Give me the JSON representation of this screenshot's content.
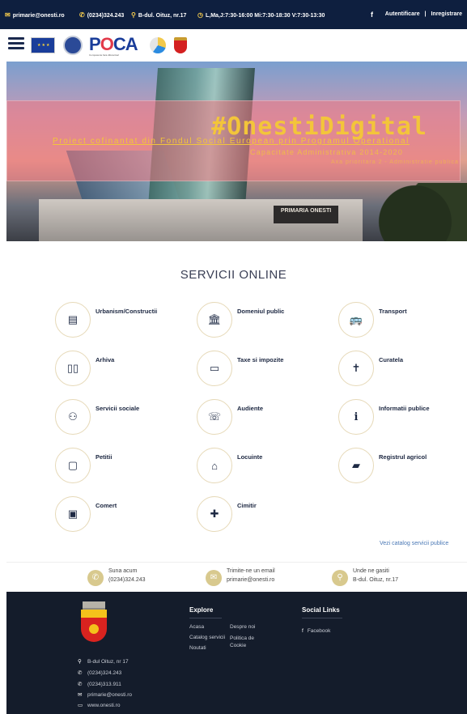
{
  "topbar": {
    "email": "primarie@onesti.ro",
    "phone": "(0234)324.243",
    "address": "B-dul. Oituz, nr.17",
    "hours": "L,Ma,J:7:30-16:00 Mi:7:30-18:30 V:7:30-13:30",
    "login": "Autentificare",
    "separator": "|",
    "register": "Inregistrare"
  },
  "logos": {
    "poca_prefix": "P",
    "poca_o": "O",
    "poca_suffix": "CA",
    "poca_sub": "Competente fara diferentieri"
  },
  "hero": {
    "title": "#OnestiDigital",
    "subtitle": "Proiect cofinantat din Fondul Social European prin Programul Operational",
    "subtitle2": "Capacitate Administrativa 2014-2020",
    "subtitle3": "Axa prioritara 2 - Administratie publica",
    "sign": "PRIMARIA ONESTI"
  },
  "services": {
    "title": "SERVICII ONLINE",
    "items": [
      {
        "label": "Urbanism/Constructii",
        "icon": "▤"
      },
      {
        "label": "Domeniul public",
        "icon": "🏛"
      },
      {
        "label": "Transport",
        "icon": "🚌"
      },
      {
        "label": "Arhiva",
        "icon": "▯▯"
      },
      {
        "label": "Taxe si impozite",
        "icon": "▭"
      },
      {
        "label": "Curatela",
        "icon": "✝"
      },
      {
        "label": "Servicii sociale",
        "icon": "⚇"
      },
      {
        "label": "Audiente",
        "icon": "☏"
      },
      {
        "label": "Informatii publice",
        "icon": "i"
      },
      {
        "label": "Petitii",
        "icon": "▢"
      },
      {
        "label": "Locuinte",
        "icon": "⌂"
      },
      {
        "label": "Registrul agricol",
        "icon": "▰"
      },
      {
        "label": "Comert",
        "icon": "▣"
      },
      {
        "label": "Cimitir",
        "icon": "✚"
      }
    ],
    "catalog_link": "Vezi catalog servicii publice"
  },
  "contact": {
    "call_label": "Suna acum",
    "call_value": "(0234)324.243",
    "email_label": "Trimite-ne un email",
    "email_value": "primarie@onesti.ro",
    "location_label": "Unde ne gasiti",
    "location_value": "B-dul. Oituz, nr.17"
  },
  "footer": {
    "explore_title": "Explore",
    "explore_links": [
      "Acasa",
      "Despre noi",
      "Catalog servicii",
      "Politica de Cookie",
      "Noutati"
    ],
    "social_title": "Social Links",
    "facebook": "Facebook",
    "address": "B-dul Oituz, nr 17",
    "phone1": "(0234)324.243",
    "phone2": "(0234)313.911",
    "email": "primarie@onesti.ro",
    "website": "www.onesti.ro"
  },
  "colors": {
    "topbar": "#0e1f3f",
    "accent_gold": "#f3c53a",
    "footer": "#141c2b",
    "circle_border": "#e6d9b8"
  }
}
